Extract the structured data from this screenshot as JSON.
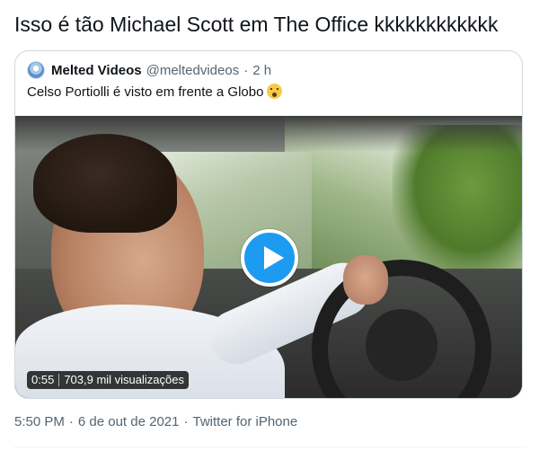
{
  "tweet": {
    "text": "Isso é tão Michael Scott em The Office kkkkkkkkkkkk",
    "timestamp": "5:50 PM",
    "separator": "·",
    "date": "6 de out de 2021",
    "source": "Twitter for iPhone"
  },
  "quote": {
    "author_name": "Melted Videos",
    "handle": "@meltedvideos",
    "separator": "·",
    "time_ago": "2 h",
    "text": "Celso Portiolli é visto em frente a Globo",
    "emoji_icon": "astonished-face-icon",
    "video": {
      "play_icon": "play-icon",
      "duration": "0:55",
      "views": "703,9 mil visualizações"
    }
  },
  "colors": {
    "accent": "#1d9bf0",
    "text": "#0f1419",
    "muted": "#536471",
    "border": "#cfd9de"
  }
}
